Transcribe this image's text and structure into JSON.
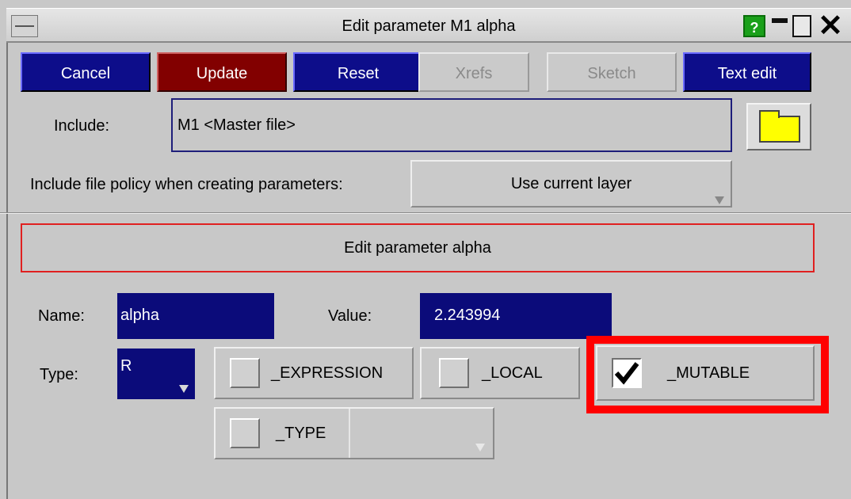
{
  "window": {
    "title": "Edit parameter M1 alpha",
    "help_label": "?"
  },
  "toolbar": {
    "cancel": "Cancel",
    "update": "Update",
    "reset": "Reset",
    "xrefs": "Xrefs",
    "sketch": "Sketch",
    "text_edit": "Text edit"
  },
  "include": {
    "label": "Include:",
    "value": "M1  <Master file>"
  },
  "policy": {
    "label": "Include file policy when creating parameters:",
    "selected": "Use current layer"
  },
  "edit_header": "Edit parameter alpha",
  "form": {
    "name_label": "Name:",
    "name_value": "alpha",
    "value_label": "Value:",
    "value_value": "2.243994",
    "type_label": "Type:",
    "type_value": "R"
  },
  "options": {
    "expression": {
      "label": "_EXPRESSION",
      "checked": false
    },
    "local": {
      "label": "_LOCAL",
      "checked": false
    },
    "mutable": {
      "label": "_MUTABLE",
      "checked": true
    },
    "type": {
      "label": "_TYPE",
      "checked": false
    }
  },
  "colors": {
    "highlight": "#ff0000",
    "button_blue": "#0d0d8a",
    "button_red": "#820000",
    "field_blue": "#0b0b7a"
  }
}
